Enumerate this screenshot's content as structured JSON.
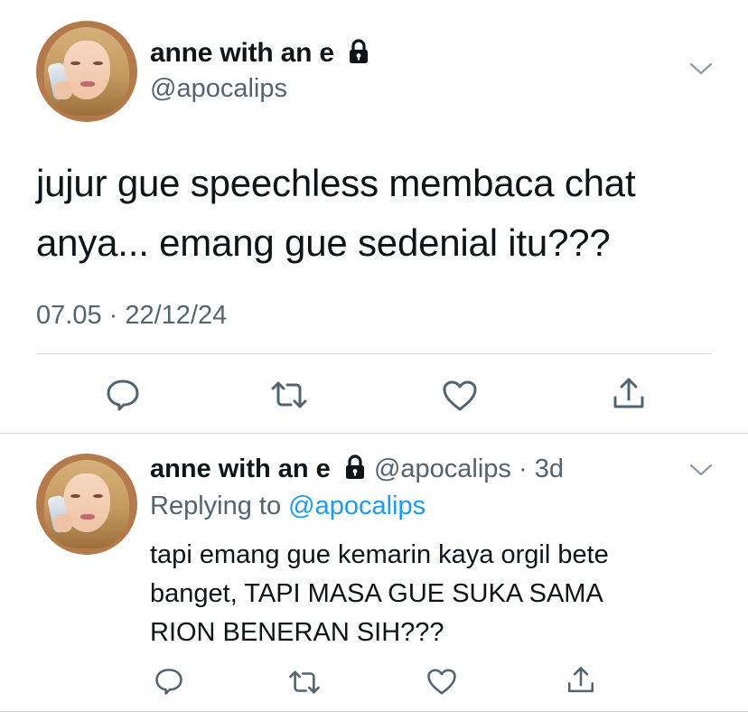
{
  "tweet": {
    "author": {
      "name": "anne with an e",
      "handle": "@apocalips",
      "protected_icon": "lock-icon"
    },
    "text_line1": "jujur gue speechless membaca chat",
    "text_line2": "anya... emang gue sedenial itu???",
    "timestamp": "07.05 · 22/12/24",
    "actions": [
      "reply-icon",
      "retweet-icon",
      "like-icon",
      "share-icon"
    ]
  },
  "reply": {
    "author": {
      "name": "anne with an e",
      "handle": "@apocalips",
      "protected_icon": "lock-icon"
    },
    "age": "· 3d",
    "replying_prefix": "Replying to",
    "replying_to": "@apocalips",
    "text_line1": "tapi emang gue kemarin kaya orgil bete",
    "text_line2": "banget, TAPI MASA GUE SUKA SAMA",
    "text_line3": "RION BENERAN SIH???",
    "actions": [
      "reply-icon",
      "retweet-icon",
      "like-icon",
      "share-icon"
    ]
  },
  "colors": {
    "text": "#0f1419",
    "secondary": "#536471",
    "accent": "#1d9bf0",
    "divider": "#cfd9de"
  }
}
